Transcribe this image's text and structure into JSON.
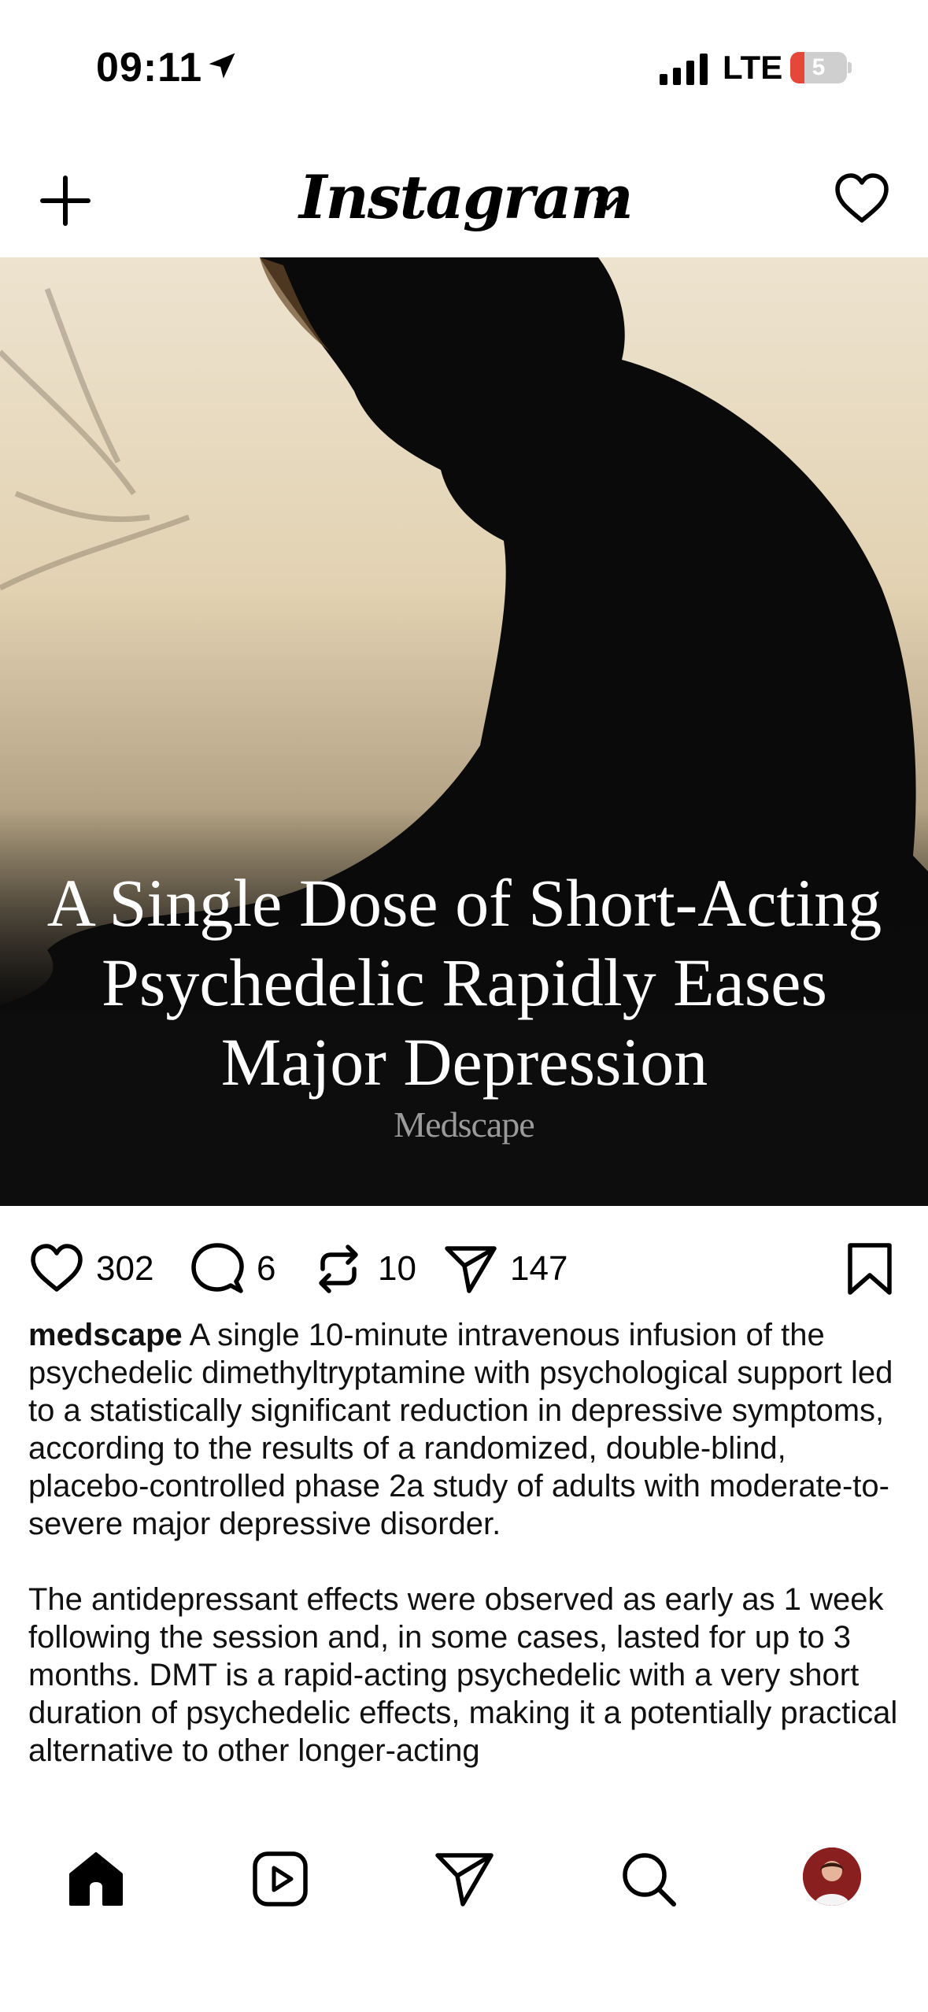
{
  "status_bar": {
    "time": "09:11",
    "network": "LTE",
    "battery_level": "5",
    "battery_color": "#e5483b",
    "icons": [
      "location-arrow-icon",
      "signal-bars-icon",
      "battery-icon"
    ]
  },
  "header": {
    "app_name": "Instagram",
    "icons": [
      "plus-icon",
      "chevron-down-icon",
      "heart-icon"
    ]
  },
  "post": {
    "image_headline": "A Single Dose of Short-Acting Psychedelic Rapidly Eases Major Depression",
    "image_brand": "Medscape",
    "likes": "302",
    "comments": "6",
    "reposts": "10",
    "shares": "147",
    "action_icons": [
      "heart-icon",
      "comment-icon",
      "repost-icon",
      "send-icon",
      "bookmark-icon"
    ]
  },
  "caption": {
    "username": "medscape",
    "paragraph1": "A single 10-minute intravenous infusion of the psychedelic dimethyltryptamine with psychological support led to a statistically significant reduction in depressive symptoms, according to the results of a randomized, double-blind, placebo-controlled phase 2a study of adults with moderate-to-severe major depressive disorder.",
    "paragraph2": "The antidepressant effects were observed as early as 1 week following the session and, in some cases, lasted for up to 3 months. DMT is a rapid-acting psychedelic with a very short duration of psychedelic effects, making it a potentially practical alternative to other longer-acting"
  },
  "tabbar": {
    "icons": [
      "home-icon",
      "reels-icon",
      "send-icon",
      "search-icon",
      "profile-avatar"
    ]
  }
}
